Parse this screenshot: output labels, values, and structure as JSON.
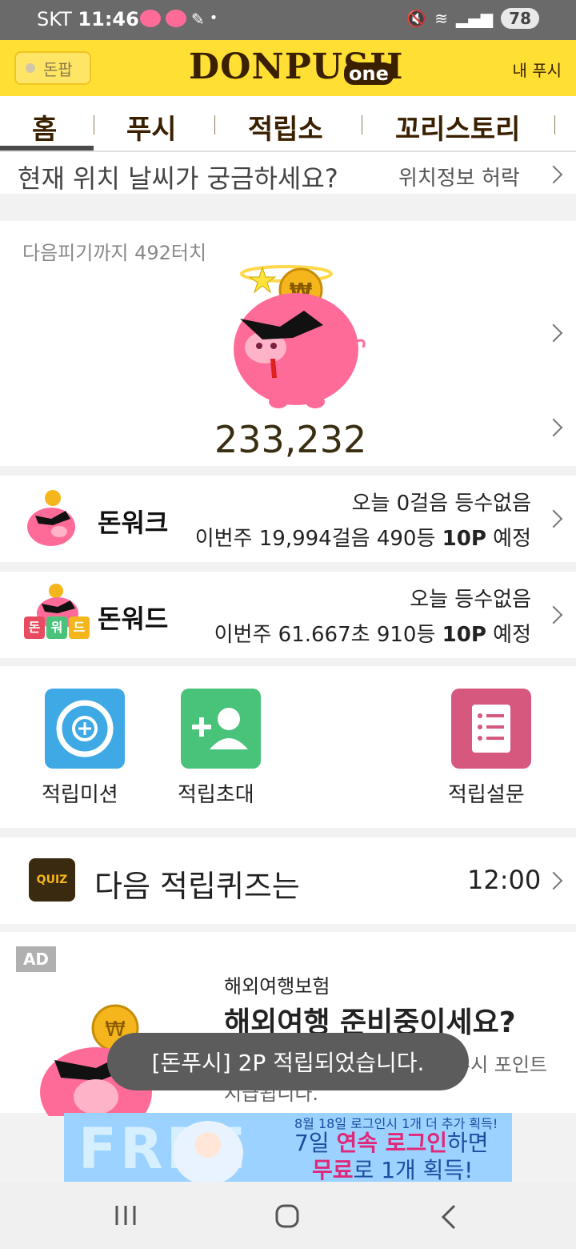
{
  "status": {
    "carrier": "SKT",
    "time": "11:46",
    "battery": "78"
  },
  "header": {
    "donpan_label": "돈팝",
    "logo": "DONPUSH",
    "logo_sub": "one",
    "my_push": "내 푸시"
  },
  "tabs": [
    {
      "label": "홈"
    },
    {
      "label": "푸시"
    },
    {
      "label": "적립소"
    },
    {
      "label": "꼬리스토리"
    }
  ],
  "weather": {
    "question": "현재 위치 날씨가 궁금하세요?",
    "action": "위치정보 허락"
  },
  "pig": {
    "next_text": "다음피기까지 492터치",
    "points": "233,232"
  },
  "donwalk": {
    "title": "돈워크",
    "today": "오늘 0걸음 등수없음",
    "week_prefix": "이번주 19,994걸음 490등 ",
    "week_points": "10P",
    "week_suffix": " 예정"
  },
  "donword": {
    "title": "돈워드",
    "today": "오늘 등수없음",
    "week_prefix": "이번주 61.667초 910등 ",
    "week_points": "10P",
    "week_suffix": " 예정",
    "badges": [
      "돈",
      "워",
      "드"
    ]
  },
  "actions": [
    {
      "label": "적립미션",
      "icon": "target-icon"
    },
    {
      "label": "적립초대",
      "icon": "add-person-icon"
    },
    {
      "label": "적립설문",
      "icon": "list-icon"
    }
  ],
  "quiz": {
    "badge": "QUIZ",
    "title": "다음 적립퀴즈는",
    "time": "12:00"
  },
  "ad": {
    "badge": "AD",
    "category": "해외여행보험",
    "headline": "해외여행 준비중이세요?",
    "desc_partial_1": "푸시 포인트",
    "desc_partial_2": "지급됩니다."
  },
  "toast": "[돈푸시] 2P 적립되었습니다.",
  "banner": {
    "bg_text": "FREE",
    "line1": "8월 18일 로그인시 1개 더 추가 획득!",
    "line2_a": "7일 ",
    "line2_b": "연속 로그인",
    "line2_c": "하면",
    "line3_a": "무료",
    "line3_b": "로 1개 획득!"
  },
  "colors": {
    "header": "#ffdf34",
    "pig": "#ff6b99",
    "mission": "#3fa9e6",
    "invite": "#49c27a",
    "survey": "#d6587f"
  }
}
